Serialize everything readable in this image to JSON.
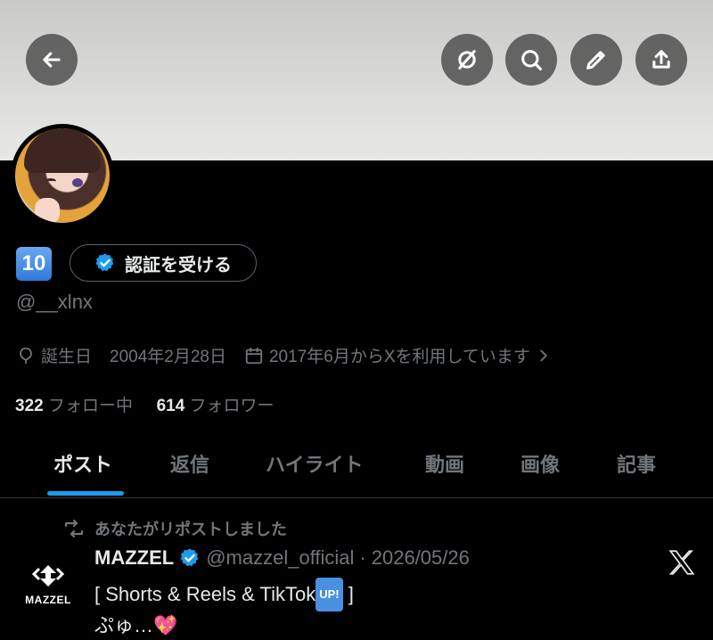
{
  "header": {
    "buttons": [
      {
        "name": "back",
        "icon": "arrow-left-icon"
      },
      {
        "name": "grok",
        "icon": "grok-icon"
      },
      {
        "name": "search",
        "icon": "search-icon"
      },
      {
        "name": "edit",
        "icon": "pencil-icon"
      },
      {
        "name": "share",
        "icon": "share-icon"
      }
    ]
  },
  "profile": {
    "display_name": "10",
    "verify_button": "認証を受ける",
    "handle": "@__xlnx",
    "birthday_label": "誕生日",
    "birthday_value": "2004年2月28日",
    "joined": "2017年6月からXを利用しています",
    "following_count": "322",
    "following_label": "フォロー中",
    "followers_count": "614",
    "followers_label": "フォロワー"
  },
  "tabs": [
    "ポスト",
    "返信",
    "ハイライト",
    "動画",
    "画像",
    "記事"
  ],
  "active_tab": "ポスト",
  "post": {
    "repost_label": "あなたがリポストしました",
    "author_name": "MAZZEL",
    "author_handle": "@mazzel_official",
    "separator": "·",
    "date": "2026/05/26",
    "avatar_text": "MAZZEL",
    "text_line1_prefix": "[ Shorts & Reels & TikTok",
    "text_badge": "UP!",
    "text_line1_suffix": " ]",
    "text_line2": "ぷゅ…💖"
  },
  "colors": {
    "accent": "#1d9bf0",
    "background": "#000000",
    "muted": "#71767b"
  }
}
